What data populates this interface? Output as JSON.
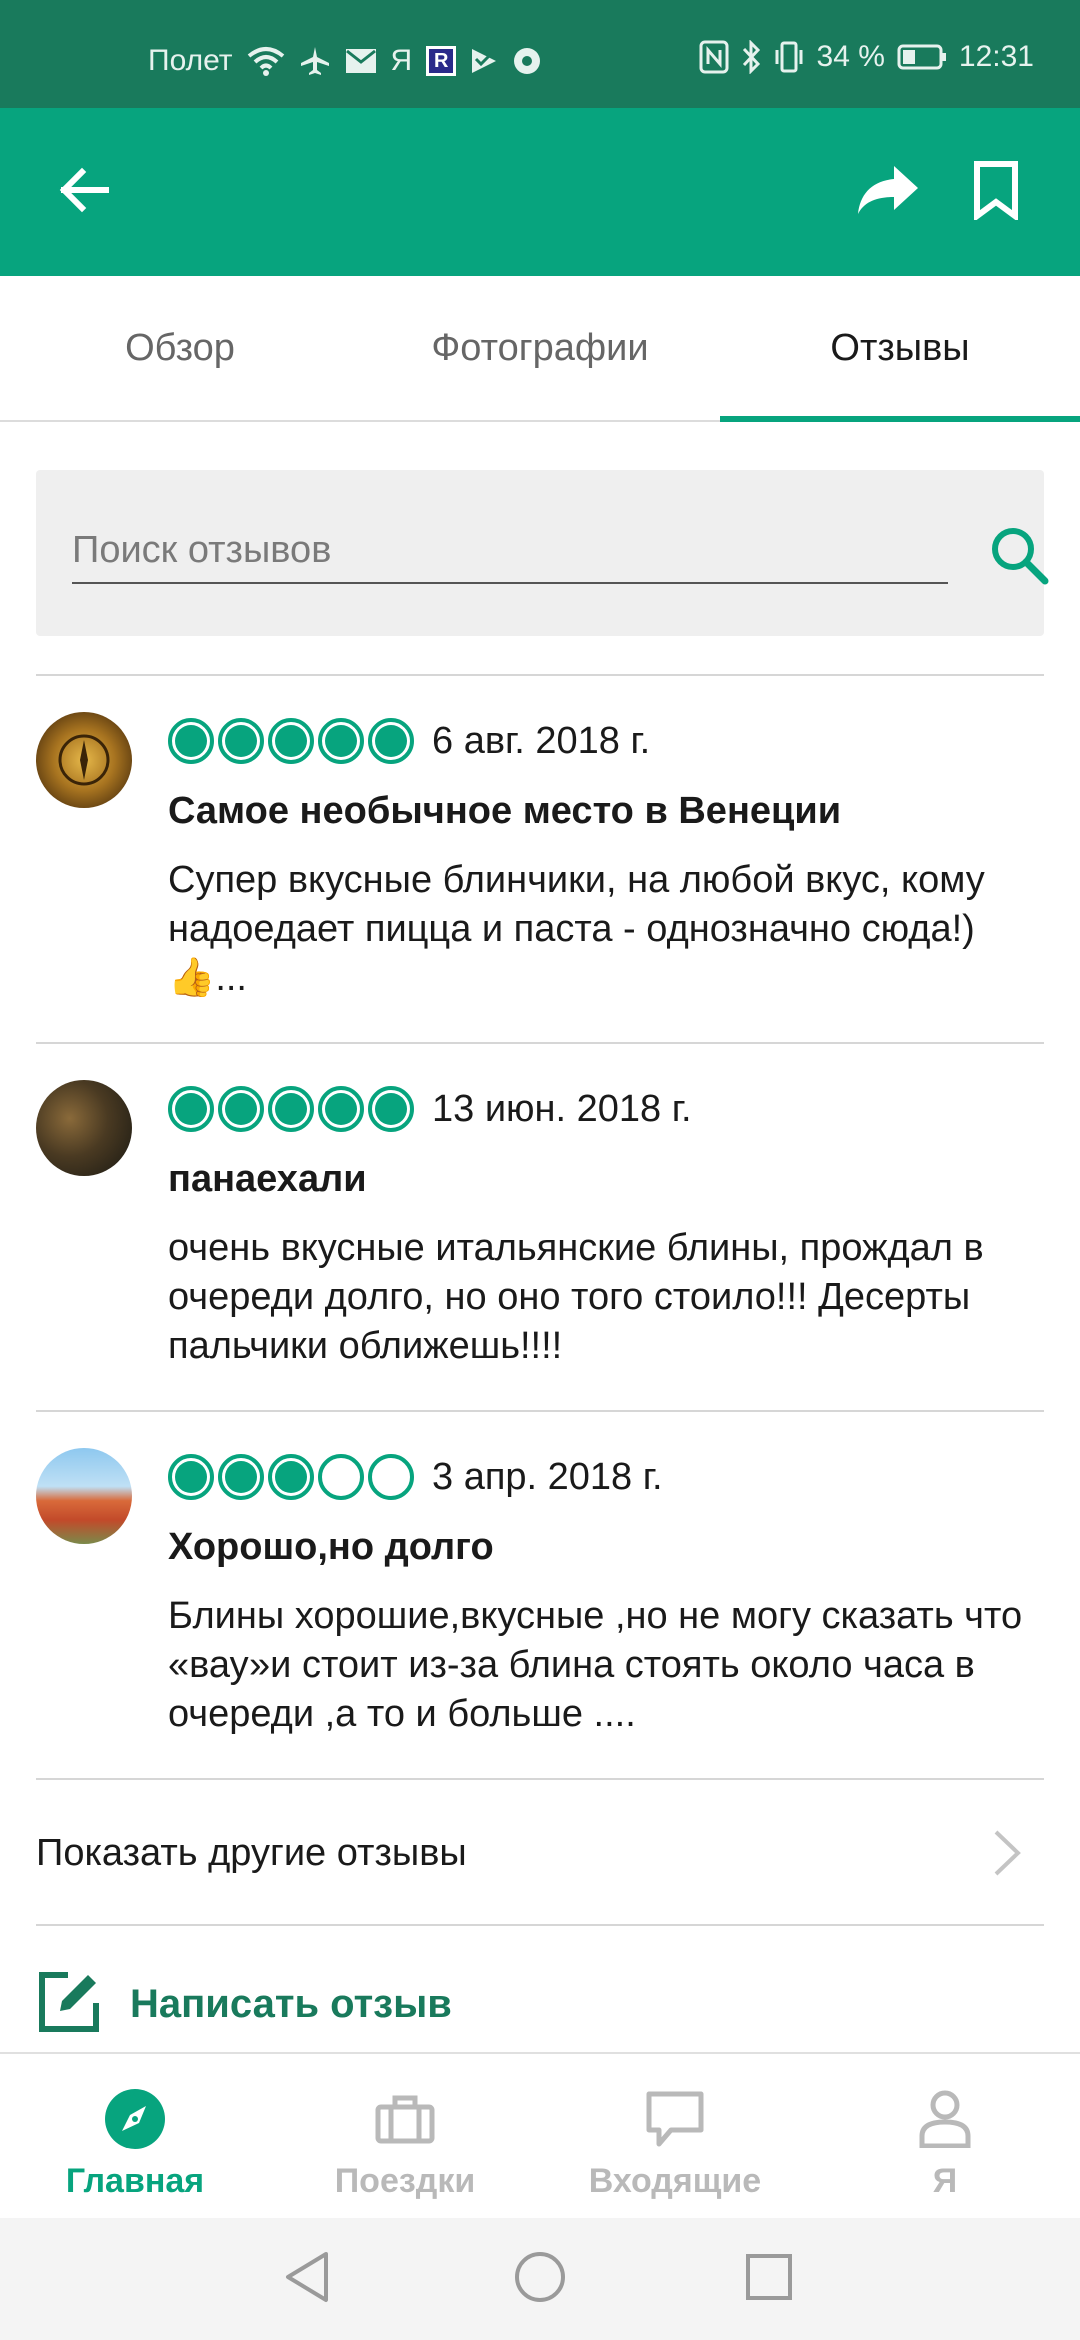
{
  "status_bar": {
    "carrier": "Полет",
    "yandex": "Я",
    "r_badge": "R",
    "battery_percent": "34 %",
    "time": "12:31"
  },
  "app_bar": {
    "icons": [
      "arrow-left-icon",
      "share-icon",
      "bookmark-icon"
    ]
  },
  "tabs": [
    {
      "label": "Обзор",
      "active": false
    },
    {
      "label": "Фотографии",
      "active": false
    },
    {
      "label": "Отзывы",
      "active": true
    }
  ],
  "search": {
    "placeholder": "Поиск отзывов",
    "value": ""
  },
  "reviews": [
    {
      "rating": 5,
      "date": "6 авг. 2018 г.",
      "title": "Самое необычное место в Венеции",
      "text": "Супер вкусные блинчики, на любой вкус, кому надоедает пицца и паста - однозначно сюда!) 👍..."
    },
    {
      "rating": 5,
      "date": "13 июн. 2018 г.",
      "title": "панаехали",
      "text": "очень вкусные итальянские блины, прождал в очереди долго, но оно того стоило!!! Десерты пальчики оближешь!!!!"
    },
    {
      "rating": 3,
      "date": "3 апр. 2018 г.",
      "title": "Хорошо,но долго",
      "text": "Блины хорошие,вкусные ,но не могу сказать что «вау»и стоит из-за блина стоять около часа в очереди ,а то и больше ...."
    }
  ],
  "more_reviews": {
    "label": "Показать другие отзывы"
  },
  "write_review": {
    "label": "Написать отзыв"
  },
  "bottom_nav": [
    {
      "label": "Главная",
      "icon": "compass-icon",
      "active": true
    },
    {
      "label": "Поездки",
      "icon": "briefcase-icon",
      "active": false
    },
    {
      "label": "Входящие",
      "icon": "chat-icon",
      "active": false
    },
    {
      "label": "Я",
      "icon": "person-icon",
      "active": false
    }
  ],
  "colors": {
    "status_bar": "#197a5c",
    "app_bar": "#07a47e",
    "accent": "#07a47e",
    "write_review_text": "#197a5c"
  }
}
